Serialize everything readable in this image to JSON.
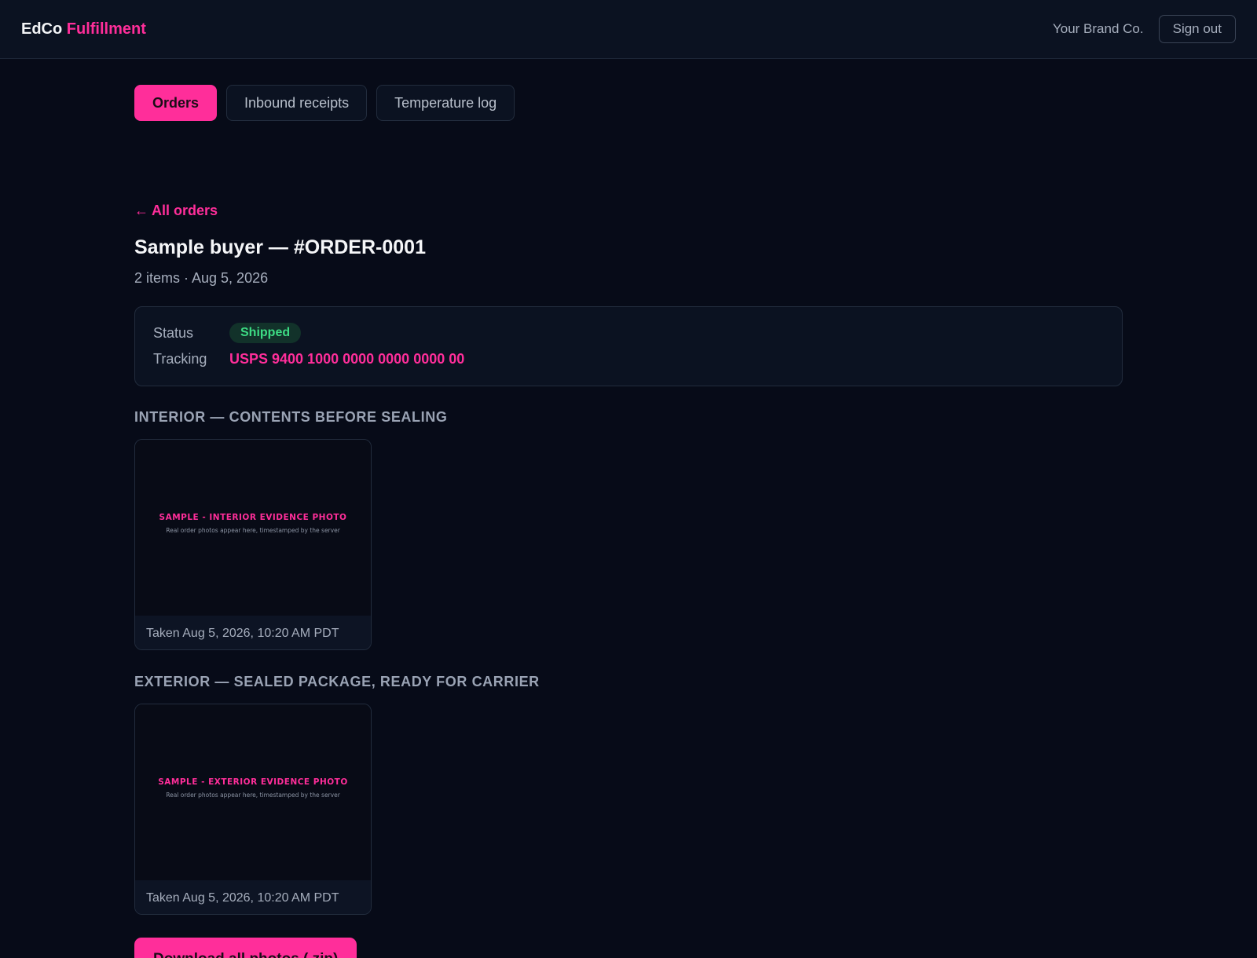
{
  "header": {
    "brand_primary": "EdCo",
    "brand_accent": "Fulfillment",
    "account_name": "Your Brand Co.",
    "sign_out_label": "Sign out"
  },
  "tabs": [
    {
      "label": "Orders",
      "active": true
    },
    {
      "label": "Inbound receipts",
      "active": false
    },
    {
      "label": "Temperature log",
      "active": false
    }
  ],
  "back_link": {
    "arrow": "←",
    "label": "All orders"
  },
  "order": {
    "title": "Sample buyer — #ORDER-0001",
    "subtitle": "2 items · Aug 5, 2026"
  },
  "status_card": {
    "status_label": "Status",
    "status_value": "Shipped",
    "tracking_label": "Tracking",
    "tracking_value": "USPS 9400 1000 0000 0000 0000 00"
  },
  "sections": [
    {
      "heading": "INTERIOR — CONTENTS BEFORE SEALING",
      "photo_title": "SAMPLE - INTERIOR EVIDENCE PHOTO",
      "photo_subtitle": "Real order photos appear here, timestamped by the server",
      "caption": "Taken Aug 5, 2026, 10:20 AM PDT"
    },
    {
      "heading": "EXTERIOR — SEALED PACKAGE, READY FOR CARRIER",
      "photo_title": "SAMPLE - EXTERIOR EVIDENCE PHOTO",
      "photo_subtitle": "Real order photos appear here, timestamped by the server",
      "caption": "Taken Aug 5, 2026, 10:20 AM PDT"
    }
  ],
  "download_label": "Download all photos (.zip)",
  "colors": {
    "accent": "#ff2e9a",
    "background": "#070b18",
    "surface": "#0b1221",
    "status_green": "#3ddc84"
  }
}
